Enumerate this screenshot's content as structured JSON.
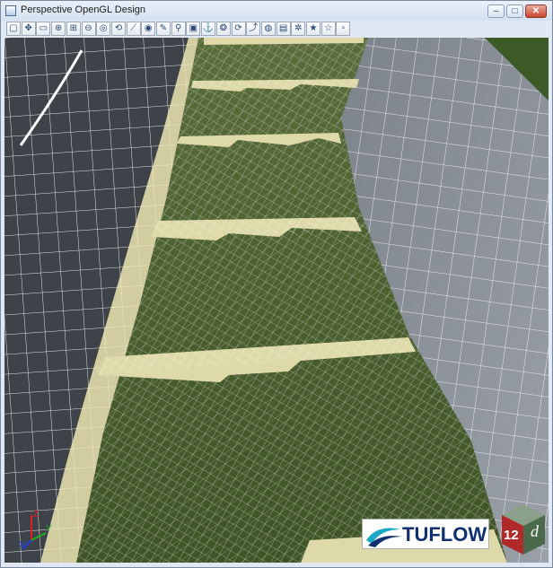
{
  "window": {
    "title": "Perspective OpenGL Design",
    "controls": [
      "minimize-icon",
      "maximize-icon",
      "close-icon"
    ],
    "control_glyphs": {
      "minimize": "–",
      "maximize": "□",
      "close": "✕"
    }
  },
  "toolbar": {
    "tools": [
      {
        "name": "new-view-icon",
        "glyph": "▢"
      },
      {
        "name": "pan-icon",
        "glyph": "✥"
      },
      {
        "name": "fit-icon",
        "glyph": "▭"
      },
      {
        "name": "zoom-in-icon",
        "glyph": "⊕"
      },
      {
        "name": "zoom-window-icon",
        "glyph": "⊞"
      },
      {
        "name": "zoom-out-icon",
        "glyph": "⊖"
      },
      {
        "name": "zoom-extents-icon",
        "glyph": "◎"
      },
      {
        "name": "zoom-previous-icon",
        "glyph": "⟲"
      },
      {
        "name": "measure-icon",
        "glyph": "⟋"
      },
      {
        "name": "eye-icon",
        "glyph": "◉"
      },
      {
        "name": "draw-icon",
        "glyph": "✎"
      },
      {
        "name": "walk-icon",
        "glyph": "⚲"
      },
      {
        "name": "camera-icon",
        "glyph": "▣"
      },
      {
        "name": "anchor-icon",
        "glyph": "⚓"
      },
      {
        "name": "navigate-icon",
        "glyph": "❂"
      },
      {
        "name": "orbit-icon",
        "glyph": "⟳"
      },
      {
        "name": "fly-icon",
        "glyph": "⤴"
      },
      {
        "name": "texture-icon",
        "glyph": "◍"
      },
      {
        "name": "layers-icon",
        "glyph": "▤"
      },
      {
        "name": "settings-icon",
        "glyph": "✲"
      },
      {
        "name": "favorite-icon",
        "glyph": "★"
      },
      {
        "name": "bookmark-star-icon",
        "glyph": "☆"
      },
      {
        "name": "window-icon",
        "glyph": "▫"
      }
    ]
  },
  "viewport": {
    "scene": "perspective-3d-terrain",
    "colors": {
      "road_left": "#3e4349",
      "road_right": "#8a8f97",
      "grass": "#4b5e30",
      "grass_dark": "#34461f",
      "embankment": "#ded9a8",
      "mesh": "#ffffff",
      "background_grass": "#3c5a26"
    }
  },
  "logos": {
    "tuflow": "TUFLOW",
    "twelve_d": {
      "number": "12",
      "letter": "d"
    }
  },
  "axes": {
    "z_color": "#e02020",
    "y_color": "#20b020",
    "x_color": "#2040e0"
  }
}
